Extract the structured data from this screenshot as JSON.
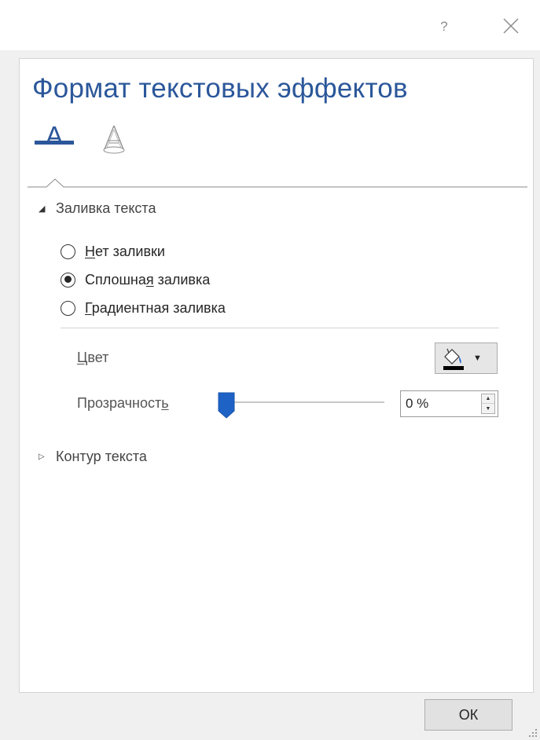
{
  "titlebar": {
    "help_icon": "question-mark-icon",
    "help_label": "?",
    "close_icon": "close-icon"
  },
  "pane": {
    "title": "Формат текстовых эффектов",
    "tabs": [
      {
        "icon": "text-fill-outline-icon",
        "glyph": "A",
        "selected": true
      },
      {
        "icon": "text-effects-icon",
        "selected": false
      }
    ]
  },
  "fill_section": {
    "header": "Заливка текста",
    "expanded": true,
    "options": [
      {
        "prefix": "",
        "accel": "Н",
        "suffix": "ет заливки",
        "checked": false
      },
      {
        "prefix": "Сплошна",
        "accel": "я",
        "suffix": " заливка",
        "checked": true
      },
      {
        "prefix": "",
        "accel": "Г",
        "suffix": "радиентная заливка",
        "checked": false
      }
    ],
    "color_label_accel": "Ц",
    "color_label_rest": "вет",
    "color_button_icon": "paint-bucket-icon",
    "color_value": "#000000",
    "transparency_label_prefix": "Прозрачност",
    "transparency_label_accel": "ь",
    "transparency_value": "0 %",
    "transparency_percent": 0
  },
  "outline_section": {
    "header": "Контур текста",
    "expanded": false
  },
  "ok_button": "ОК",
  "colors": {
    "accent": "#2b579a",
    "slider_thumb": "#1e62c6"
  }
}
